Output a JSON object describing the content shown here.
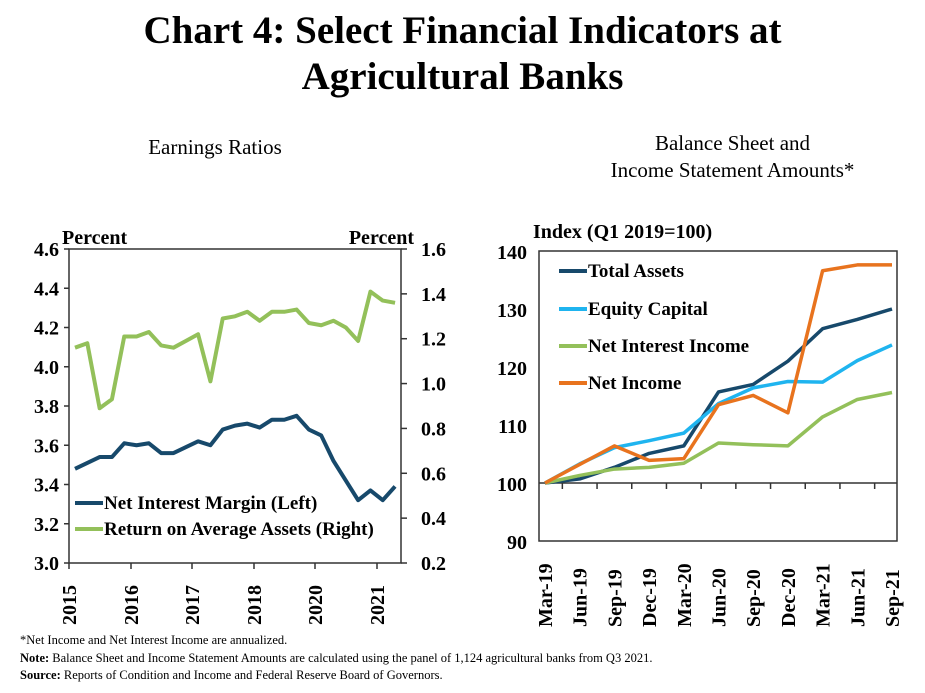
{
  "title_line1": "Chart 4: Select Financial Indicators at",
  "title_line2": "Agricultural Banks",
  "footnotes": {
    "asterisk": "*Net Income and Net Interest Income are annualized.",
    "note_label": "Note:",
    "note_text": " Balance Sheet and Income Statement Amounts are calculated using the panel of 1,124 agricultural banks from Q3 2021.",
    "source_label": "Source:",
    "source_text": " Reports of Condition and Income and Federal Reserve Board of Governors."
  },
  "colors": {
    "navy": "#17496b",
    "light_blue": "#1fb4ef",
    "green": "#93c05a",
    "orange": "#e8731e"
  },
  "chart_data": [
    {
      "type": "line",
      "title": "Earnings Ratios",
      "ylabel_left": "Percent",
      "ylabel_right": "Percent",
      "ylim_left": [
        3.0,
        4.6
      ],
      "yticks_left": [
        "3.0",
        "3.2",
        "3.4",
        "3.6",
        "3.8",
        "4.0",
        "4.2",
        "4.4",
        "4.6"
      ],
      "ylim_right": [
        0.2,
        1.6
      ],
      "yticks_right": [
        "0.2",
        "0.4",
        "0.6",
        "0.8",
        "1.0",
        "1.2",
        "1.4",
        "1.6"
      ],
      "xtick_labels": [
        "2015",
        "2016",
        "2017",
        "2018",
        "2020",
        "2021"
      ],
      "x": "quarterly, 27 observations starting Q1 2015",
      "grid": false,
      "legend_position": "bottom-left",
      "series": [
        {
          "name": "Net Interest Margin (Left)",
          "axis": "left",
          "color": "#17496b",
          "values": [
            3.48,
            3.51,
            3.54,
            3.54,
            3.61,
            3.6,
            3.61,
            3.56,
            3.56,
            3.59,
            3.62,
            3.6,
            3.68,
            3.7,
            3.71,
            3.69,
            3.73,
            3.73,
            3.75,
            3.68,
            3.65,
            3.52,
            3.42,
            3.32,
            3.37,
            3.32,
            3.39
          ]
        },
        {
          "name": "Return on Average Assets (Right)",
          "axis": "right",
          "color": "#93c05a",
          "values": [
            1.16,
            1.18,
            0.89,
            0.93,
            1.21,
            1.21,
            1.23,
            1.17,
            1.16,
            1.19,
            1.22,
            1.01,
            1.29,
            1.3,
            1.32,
            1.28,
            1.32,
            1.32,
            1.33,
            1.27,
            1.26,
            1.28,
            1.25,
            1.19,
            1.41,
            1.37,
            1.36
          ]
        }
      ]
    },
    {
      "type": "line",
      "title": "Balance Sheet and Income Statement Amounts*",
      "ylabel": "Index (Q1 2019=100)",
      "ylim": [
        90,
        140
      ],
      "yticks": [
        "90",
        "100",
        "110",
        "120",
        "130",
        "140"
      ],
      "categories": [
        "Mar-19",
        "Jun-19",
        "Sep-19",
        "Dec-19",
        "Mar-20",
        "Jun-20",
        "Sep-20",
        "Dec-20",
        "Mar-21",
        "Jun-21",
        "Sep-21"
      ],
      "grid": false,
      "legend_position": "top-left",
      "series": [
        {
          "name": "Total Assets",
          "color": "#17496b",
          "values": [
            100,
            100.7,
            102.7,
            105.1,
            106.4,
            115.7,
            117.0,
            121.0,
            126.6,
            128.2,
            130.0
          ]
        },
        {
          "name": "Equity Capital",
          "color": "#1fb4ef",
          "values": [
            100,
            103.3,
            106.1,
            107.3,
            108.6,
            113.7,
            116.4,
            117.5,
            117.4,
            121.1,
            123.8
          ]
        },
        {
          "name": "Net Interest Income",
          "color": "#93c05a",
          "values": [
            100,
            101.3,
            102.4,
            102.7,
            103.4,
            106.9,
            106.6,
            106.4,
            111.4,
            114.4,
            115.6
          ]
        },
        {
          "name": "Net Income",
          "color": "#e8731e",
          "values": [
            100,
            103.2,
            106.4,
            103.9,
            104.2,
            113.5,
            115.1,
            112.1,
            136.6,
            137.6,
            137.6
          ]
        }
      ]
    }
  ]
}
